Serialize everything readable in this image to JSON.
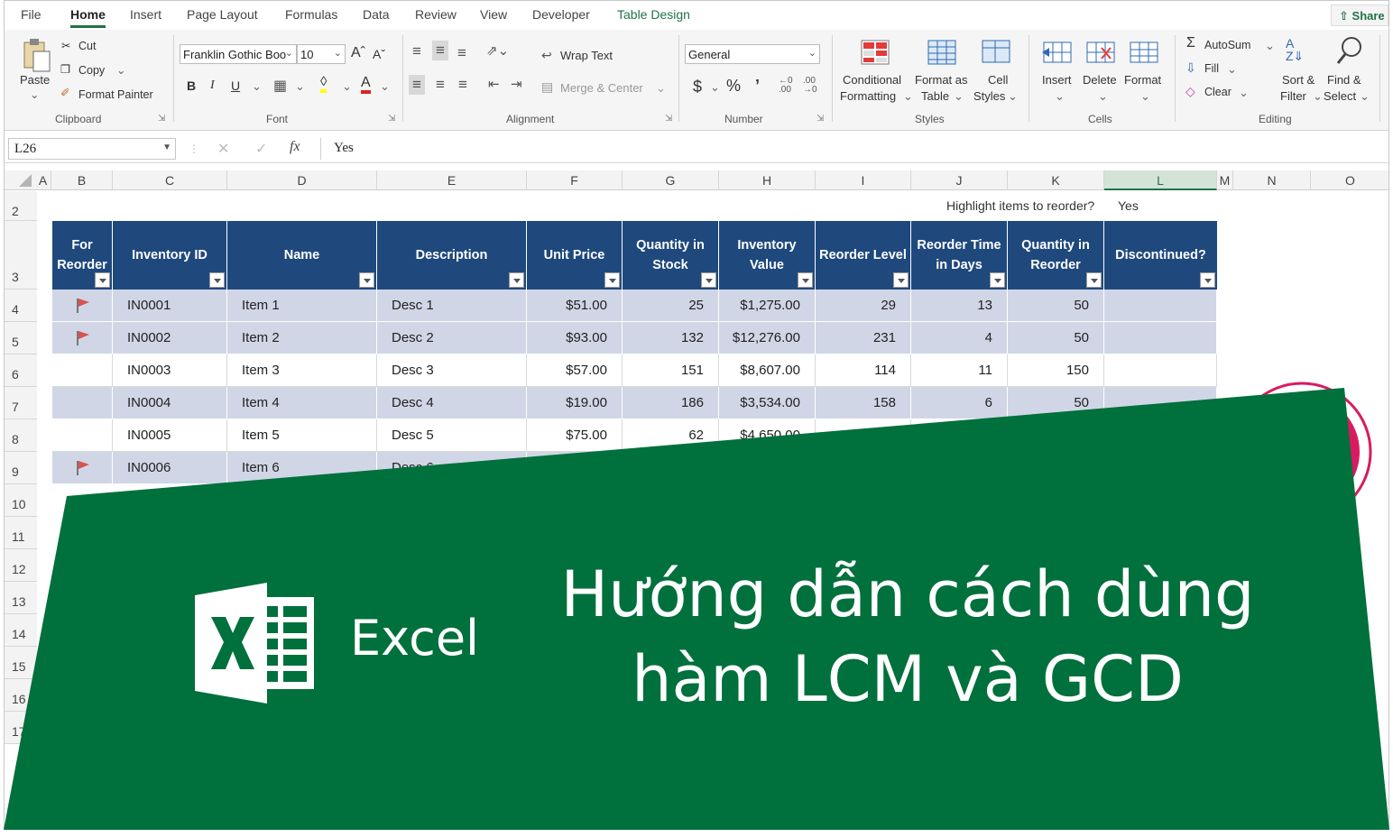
{
  "ribbon": {
    "tabs": [
      "File",
      "Home",
      "Insert",
      "Page Layout",
      "Formulas",
      "Data",
      "Review",
      "View",
      "Developer",
      "Table Design"
    ],
    "share": "Share",
    "clipboard": {
      "paste": "Paste",
      "cut": "Cut",
      "copy": "Copy",
      "format_painter": "Format Painter",
      "label": "Clipboard"
    },
    "font": {
      "name": "Franklin Gothic Boo",
      "size": "10",
      "label": "Font"
    },
    "alignment": {
      "wrap_text": "Wrap Text",
      "merge_center": "Merge & Center",
      "label": "Alignment"
    },
    "number": {
      "format": "General",
      "label": "Number"
    },
    "styles": {
      "conditional_1": "Conditional",
      "conditional_2": "Formatting",
      "format_table_1": "Format as",
      "format_table_2": "Table",
      "cell_styles_1": "Cell",
      "cell_styles_2": "Styles",
      "label": "Styles"
    },
    "cells": {
      "insert": "Insert",
      "delete": "Delete",
      "format": "Format",
      "label": "Cells"
    },
    "editing": {
      "autosum": "AutoSum",
      "fill": "Fill",
      "clear": "Clear",
      "sort_1": "Sort &",
      "sort_2": "Filter",
      "find_1": "Find &",
      "find_2": "Select",
      "label": "Editing"
    }
  },
  "formula_bar": {
    "name_box": "L26",
    "value": "Yes"
  },
  "columns": [
    "A",
    "B",
    "C",
    "D",
    "E",
    "F",
    "G",
    "H",
    "I",
    "J",
    "K",
    "L",
    "M",
    "N",
    "O"
  ],
  "rows": [
    "2",
    "3",
    "4",
    "5",
    "6",
    "7",
    "8",
    "9",
    "10",
    "11",
    "12",
    "13",
    "14",
    "15",
    "16",
    "17"
  ],
  "highlight": {
    "label": "Highlight items to reorder?",
    "value": "Yes"
  },
  "table": {
    "headers": [
      "For Reorder",
      "Inventory ID",
      "Name",
      "Description",
      "Unit Price",
      "Quantity in Stock",
      "Inventory Value",
      "Reorder Level",
      "Reorder Time in Days",
      "Quantity in Reorder",
      "Discontinued?"
    ],
    "rows": [
      {
        "flag": true,
        "id": "IN0001",
        "name": "Item 1",
        "desc": "Desc 1",
        "price": "$51.00",
        "qty": "25",
        "value": "$1,275.00",
        "level": "29",
        "days": "13",
        "reorder": "50"
      },
      {
        "flag": true,
        "id": "IN0002",
        "name": "Item 2",
        "desc": "Desc 2",
        "price": "$93.00",
        "qty": "132",
        "value": "$12,276.00",
        "level": "231",
        "days": "4",
        "reorder": "50"
      },
      {
        "flag": false,
        "id": "IN0003",
        "name": "Item 3",
        "desc": "Desc 3",
        "price": "$57.00",
        "qty": "151",
        "value": "$8,607.00",
        "level": "114",
        "days": "11",
        "reorder": "150"
      },
      {
        "flag": false,
        "id": "IN0004",
        "name": "Item 4",
        "desc": "Desc 4",
        "price": "$19.00",
        "qty": "186",
        "value": "$3,534.00",
        "level": "158",
        "days": "6",
        "reorder": "50"
      },
      {
        "flag": false,
        "id": "IN0005",
        "name": "Item 5",
        "desc": "Desc 5",
        "price": "$75.00",
        "qty": "62",
        "value": "$4,650.00",
        "level": "",
        "days": "",
        "reorder": ""
      },
      {
        "flag": true,
        "id": "IN0006",
        "name": "Item 6",
        "desc": "Desc 6",
        "price": "",
        "qty": "",
        "value": "",
        "level": "",
        "days": "",
        "reorder": ""
      }
    ]
  },
  "banner": {
    "excel_word": "Excel",
    "title_line1": "Hướng dẫn cách dùng",
    "title_line2": "hàm LCM và GCD"
  },
  "colors": {
    "excel_green": "#217346",
    "banner_green": "#00703c",
    "header_blue": "#1f497d",
    "band_blue": "#d0d6e6",
    "flag_red": "#d9534f",
    "logo_pink": "#d81b60"
  },
  "icons": [
    "share-icon",
    "paste-icon",
    "cut-icon",
    "copy-icon",
    "format-painter-icon",
    "flag-icon",
    "brand-logo",
    "excel-logo"
  ]
}
